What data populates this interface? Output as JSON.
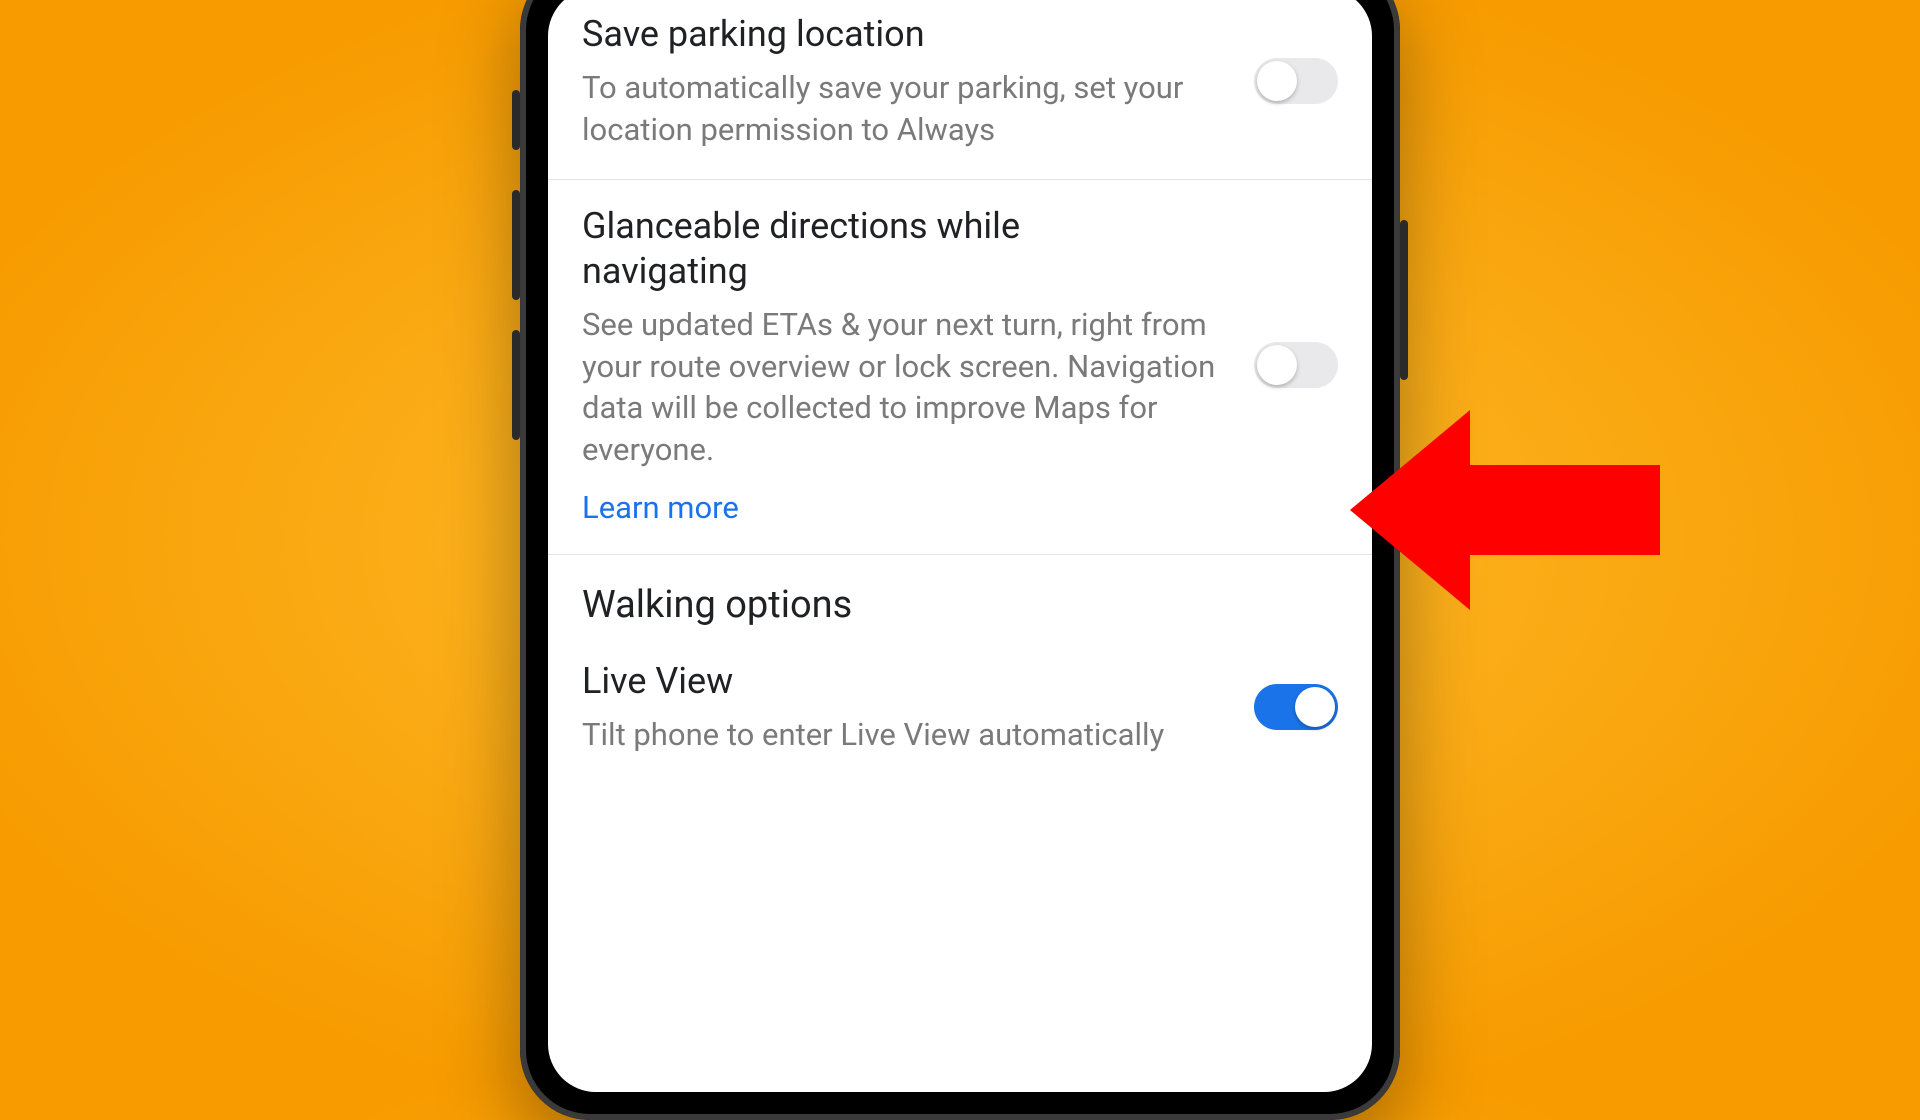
{
  "colors": {
    "accent_on": "#1a73e8",
    "accent_off_track": "#e9e9eb",
    "arrow": "#ff0000",
    "link": "#1a73e8"
  },
  "settings": {
    "parking": {
      "title": "Save parking location",
      "desc": "To automatically save your parking, set your location permission to Always",
      "enabled": false
    },
    "glanceable": {
      "title": "Glanceable directions while navigating",
      "desc": "See updated ETAs & your next turn, right from your route overview or lock screen. Navigation data will be collected to improve Maps for everyone.",
      "learn_more": "Learn more",
      "enabled": false
    },
    "walking_section": "Walking options",
    "live_view": {
      "title": "Live View",
      "desc": "Tilt phone to enter Live View automatically",
      "enabled": true
    }
  },
  "annotation": {
    "type": "arrow-left",
    "target": "glanceable-toggle"
  }
}
